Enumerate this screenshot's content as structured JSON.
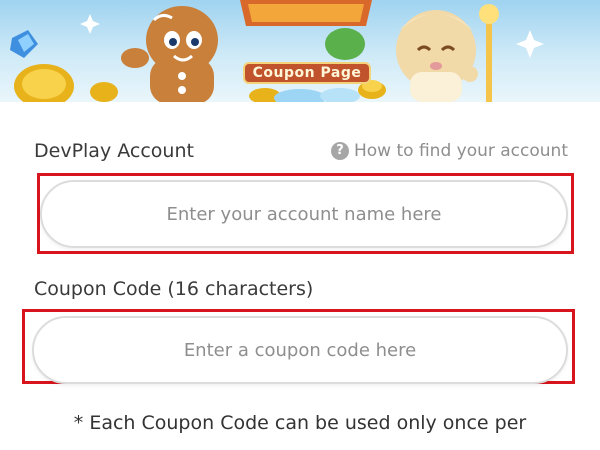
{
  "banner": {
    "title": "Coupon Page"
  },
  "account": {
    "label": "DevPlay Account",
    "help_text": "How to find your account",
    "placeholder": "Enter your account name here"
  },
  "coupon": {
    "label": "Coupon Code (16 characters)",
    "placeholder": "Enter a coupon code here"
  },
  "note": "* Each Coupon Code can be used only once per",
  "colors": {
    "highlight": "#d8141c",
    "banner_sky": "#9fd3f0",
    "title_plate": "#c0532c"
  }
}
